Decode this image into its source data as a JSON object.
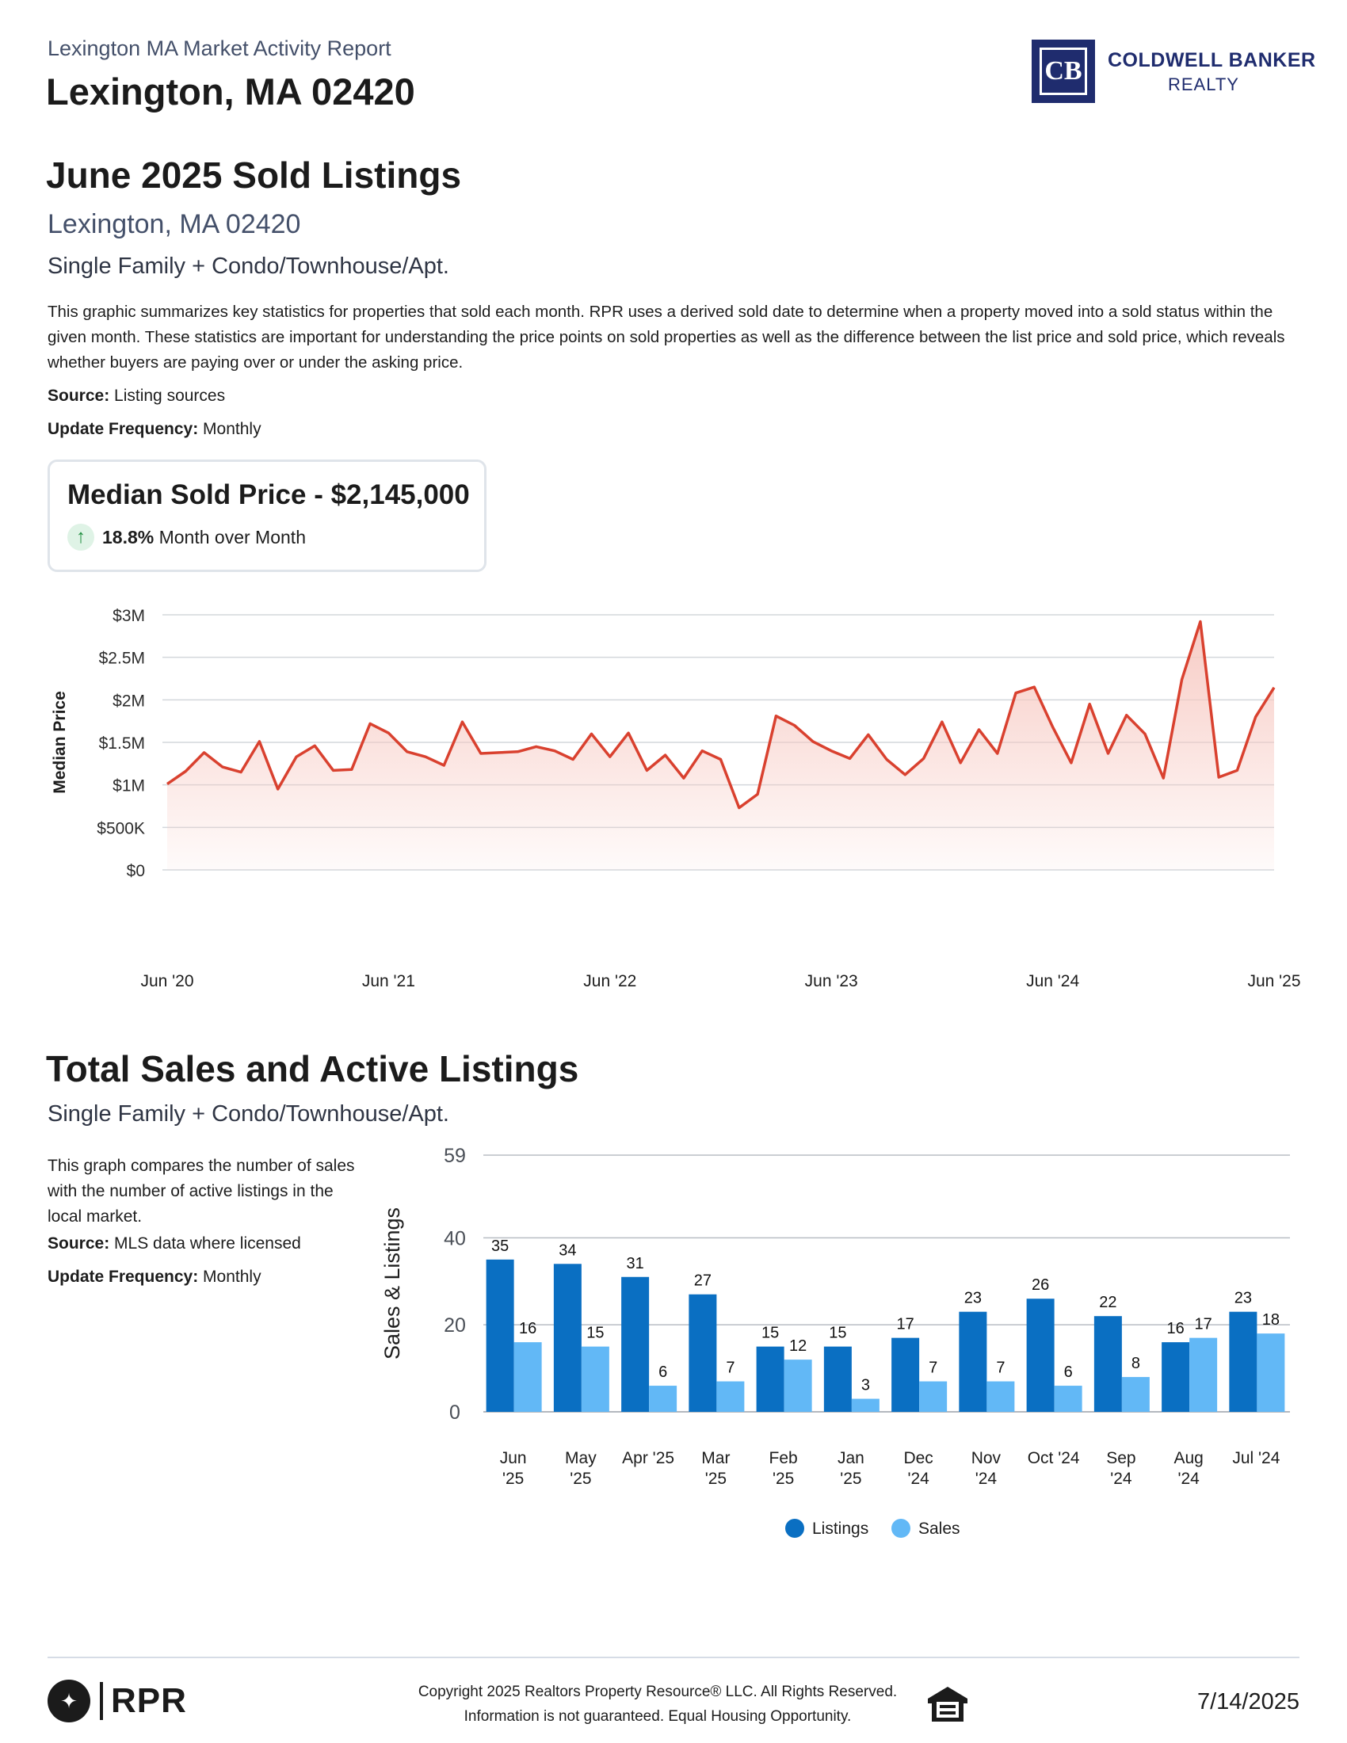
{
  "header": {
    "report_title": "Lexington MA Market Activity Report",
    "place_title": "Lexington, MA 02420",
    "brand_line1": "COLDWELL BANKER",
    "brand_line2": "REALTY",
    "logo_letters": "CB"
  },
  "sold_section": {
    "title": "June 2025 Sold Listings",
    "location": "Lexington, MA 02420",
    "property_types": "Single Family + Condo/Townhouse/Apt.",
    "description": "This graphic summarizes key statistics for properties that sold each month. RPR uses a derived sold date to determine when a property moved into a sold status within the given month. These statistics are important for understanding the price points on sold properties as well as the difference between the list price and sold price, which reveals whether buyers are paying over or under the asking price.",
    "source_label": "Source:",
    "source_value": "Listing sources",
    "update_label": "Update Frequency:",
    "update_value": "Monthly",
    "kpi_title": "Median Sold Price - $2,145,000",
    "kpi_change_value": "18.8%",
    "kpi_change_label": "Month over Month",
    "kpi_direction": "up",
    "kpi_icon": "arrow-up-icon"
  },
  "sales_section": {
    "title": "Total Sales and Active Listings",
    "property_types": "Single Family + Condo/Townhouse/Apt.",
    "description": "This graph compares the number of sales with the number of active listings in the local market.",
    "source_label": "Source:",
    "source_value": "MLS data where licensed",
    "update_label": "Update Frequency:",
    "update_value": "Monthly"
  },
  "footer": {
    "rpr_label": "RPR",
    "copyright_line1": "Copyright 2025 Realtors Property Resource® LLC. All Rights Reserved.",
    "copyright_line2": "Information is not guaranteed. Equal Housing Opportunity.",
    "date": "7/14/2025",
    "equal_housing_icon": "equal-housing-icon"
  },
  "chart_data": [
    {
      "type": "area",
      "ylabel": "Median Price",
      "ylim": [
        0,
        3000000
      ],
      "y_ticks": [
        0,
        500000,
        1000000,
        1500000,
        2000000,
        2500000,
        3000000
      ],
      "y_tick_labels": [
        "$0",
        "$500K",
        "$1M",
        "$1.5M",
        "$2M",
        "$2.5M",
        "$3M"
      ],
      "x_tick_labels": [
        "Jun '20",
        "Jun '21",
        "Jun '22",
        "Jun '23",
        "Jun '24",
        "Jun '25"
      ],
      "x_tick_index": [
        0,
        12,
        24,
        36,
        48,
        60
      ],
      "line_color": "#d9412f",
      "fill_color": "#f7c9c2",
      "grid": true,
      "series": [
        {
          "values": [
            1010000,
            1160000,
            1380000,
            1210000,
            1150000,
            1510000,
            950000,
            1330000,
            1460000,
            1170000,
            1180000,
            1720000,
            1610000,
            1390000,
            1330000,
            1230000,
            1740000,
            1370000,
            1380000,
            1390000,
            1450000,
            1400000,
            1300000,
            1600000,
            1330000,
            1610000,
            1170000,
            1350000,
            1080000,
            1400000,
            1300000,
            730000,
            890000,
            1810000,
            1700000,
            1510000,
            1400000,
            1310000,
            1590000,
            1300000,
            1120000,
            1310000,
            1740000,
            1260000,
            1650000,
            1370000,
            2080000,
            2150000,
            1680000,
            1260000,
            1950000,
            1370000,
            1820000,
            1600000,
            1080000,
            2240000,
            2920000,
            1090000,
            1170000,
            1800000,
            2145000
          ]
        }
      ]
    },
    {
      "type": "bar",
      "ylabel": "Sales & Listings",
      "ylim": [
        0,
        59
      ],
      "y_ticks": [
        0,
        20,
        40,
        59
      ],
      "categories": [
        [
          "Jun",
          "'25"
        ],
        [
          "May",
          "'25"
        ],
        [
          "Apr '25"
        ],
        [
          "Mar",
          "'25"
        ],
        [
          "Feb",
          "'25"
        ],
        [
          "Jan",
          "'25"
        ],
        [
          "Dec",
          "'24"
        ],
        [
          "Nov",
          "'24"
        ],
        [
          "Oct '24"
        ],
        [
          "Sep",
          "'24"
        ],
        [
          "Aug",
          "'24"
        ],
        [
          "Jul '24"
        ]
      ],
      "series": [
        {
          "name": "Listings",
          "color": "#0a6fc2",
          "values": [
            35,
            34,
            31,
            27,
            15,
            15,
            17,
            23,
            26,
            22,
            16,
            23
          ]
        },
        {
          "name": "Sales",
          "color": "#62b8f6",
          "values": [
            16,
            15,
            6,
            7,
            12,
            3,
            7,
            7,
            6,
            8,
            17,
            18
          ]
        }
      ],
      "legend_position": "bottom-center",
      "grid": true
    }
  ]
}
